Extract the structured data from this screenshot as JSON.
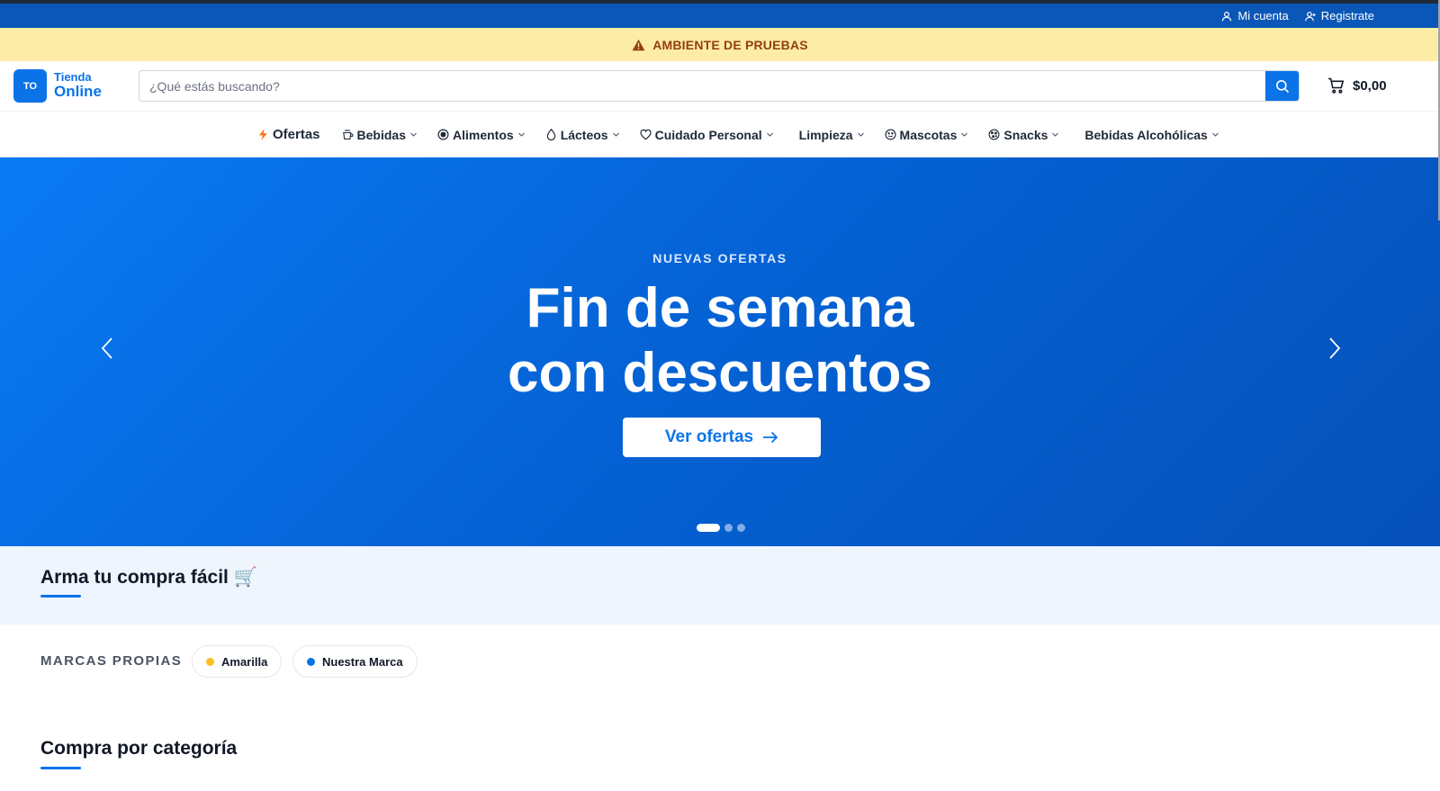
{
  "top_bar": {
    "account_label": "Mi cuenta",
    "register_label": "Registrate"
  },
  "banner": {
    "text": "AMBIENTE DE PRUEBAS",
    "color": "#92400e",
    "icon": "warning-icon"
  },
  "header": {
    "logo_initials": "TO",
    "logo_line1": "Tienda",
    "logo_line2": "Online",
    "search_placeholder": "¿Qué estás buscando?",
    "search_value": "",
    "cart_total": "$0,00",
    "accent_color": "#0b73e8"
  },
  "nav": {
    "items": [
      {
        "label": "Ofertas",
        "icon": "lightning-icon"
      },
      {
        "label": "Bebidas",
        "icon": "cup-icon"
      },
      {
        "label": "Alimentos",
        "icon": "plate-icon"
      },
      {
        "label": "Lácteos",
        "icon": "drop-icon"
      },
      {
        "label": "Cuidado Personal",
        "icon": "heart-icon"
      },
      {
        "label": "Limpieza",
        "icon": ""
      },
      {
        "label": "Mascotas",
        "icon": "smiley-icon"
      },
      {
        "label": "Snacks",
        "icon": "cookie-icon"
      },
      {
        "label": "Bebidas Alcohólicas",
        "icon": ""
      }
    ]
  },
  "hero": {
    "eyebrow": "NUEVAS OFERTAS",
    "title_line1": "Fin de semana",
    "title_line2": "con descuentos",
    "cta_label": "Ver ofertas",
    "slide_count": 3,
    "active_slide": 1
  },
  "sections": {
    "easy_title": "Arma tu compra fácil 🛒",
    "brands_label": "MARCAS PROPIAS",
    "brands": [
      {
        "name": "Amarilla",
        "color": "#fbbf24"
      },
      {
        "name": "Nuestra Marca",
        "color": "#0b73e8"
      }
    ],
    "category_title": "Compra por categoría"
  }
}
